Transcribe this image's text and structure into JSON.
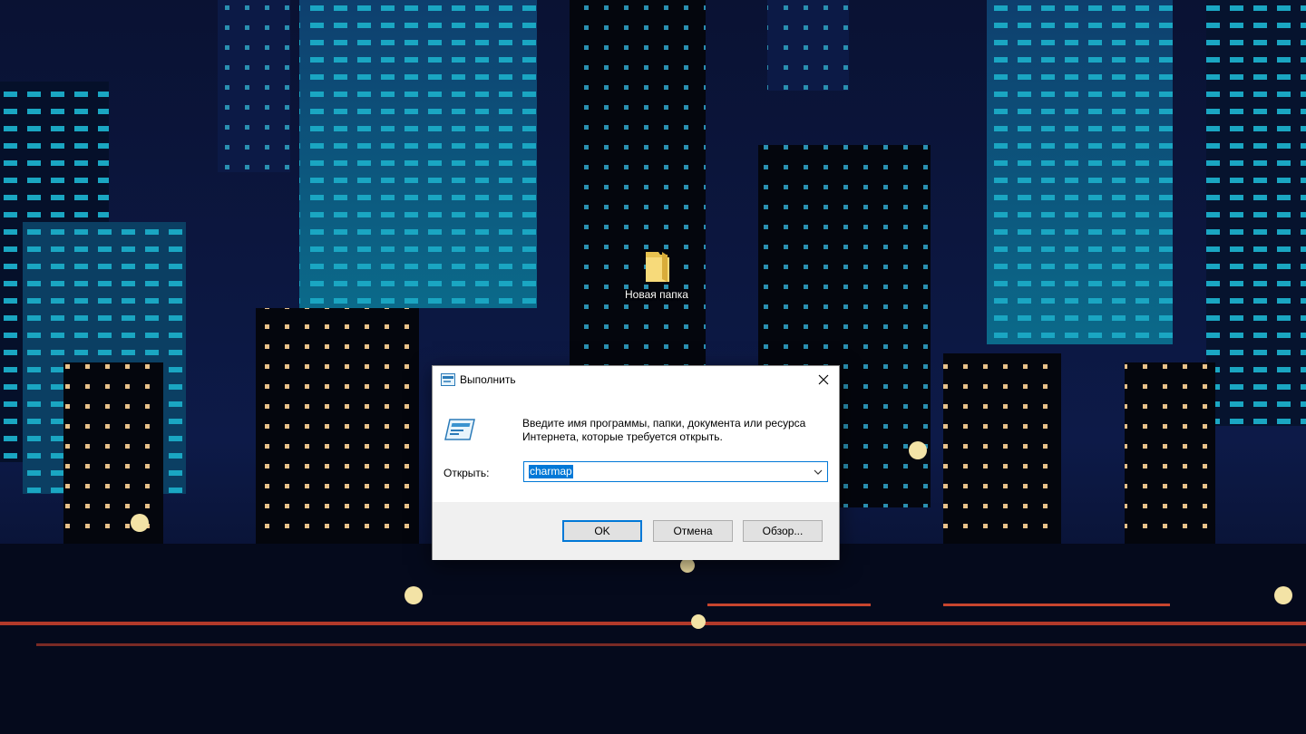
{
  "desktop": {
    "icons": [
      {
        "label": "Новая папка",
        "icon": "folder-icon"
      }
    ]
  },
  "run_dialog": {
    "title": "Выполнить",
    "description": "Введите имя программы, папки, документа или ресурса Интернета, которые требуется открыть.",
    "open_label": "Открыть:",
    "open_value": "charmap",
    "buttons": {
      "ok": "OK",
      "cancel": "Отмена",
      "browse": "Обзор..."
    },
    "icons": {
      "app": "run-icon",
      "close": "close-icon",
      "dropdown": "chevron-down-icon"
    }
  },
  "colors": {
    "accent": "#0078d7",
    "dialog_footer": "#f0f0f0",
    "button_face": "#e1e1e1",
    "sky": "#07102a",
    "building_teal": "#127a96",
    "window_amber": "#f0b060"
  }
}
